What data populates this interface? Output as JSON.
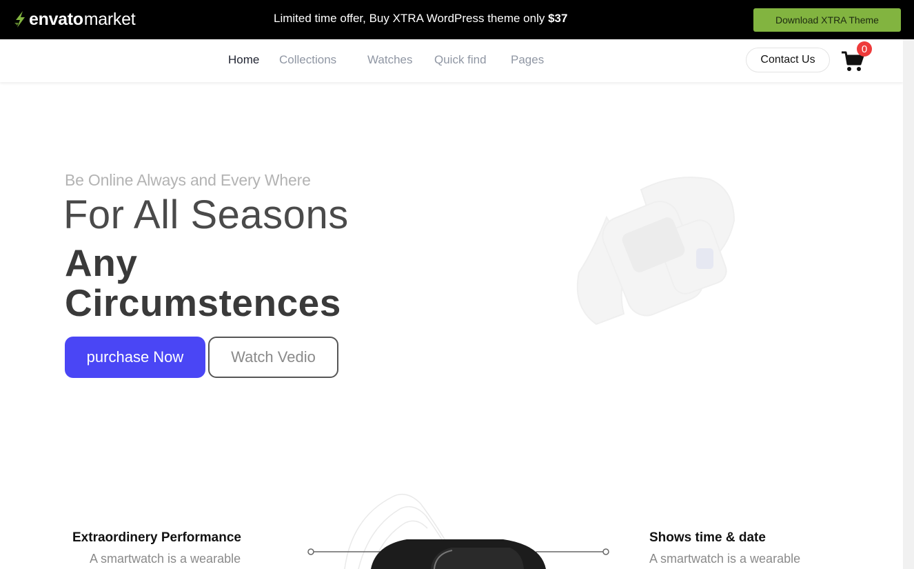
{
  "promo": {
    "logo_bold": "envato",
    "logo_light": "market",
    "text": "Limited time offer, Buy XTRA WordPress theme only ",
    "price": "$37",
    "download_label": "Download XTRA Theme"
  },
  "nav": {
    "items": [
      {
        "label": "Home"
      },
      {
        "label": "Collections"
      },
      {
        "label": "Watches"
      },
      {
        "label": "Quick find"
      },
      {
        "label": "Pages"
      }
    ],
    "contact_label": "Contact Us",
    "cart_count": "0"
  },
  "hero": {
    "subtitle": "Be Online Always and Every Where",
    "title": "For All Seasons",
    "bold_line1": "Any",
    "bold_line2": "Circumstences",
    "purchase_label": "purchase Now",
    "watch_label": "Watch Vedio"
  },
  "features": {
    "left": {
      "title": "Extraordinery Performance",
      "desc": "A smartwatch is a wearable"
    },
    "right": {
      "title": "Shows time & date",
      "desc": "A smartwatch is a wearable"
    }
  },
  "colors": {
    "accent": "#4a46f5",
    "download_green": "#82b440",
    "badge_red": "#ee3b3b"
  }
}
